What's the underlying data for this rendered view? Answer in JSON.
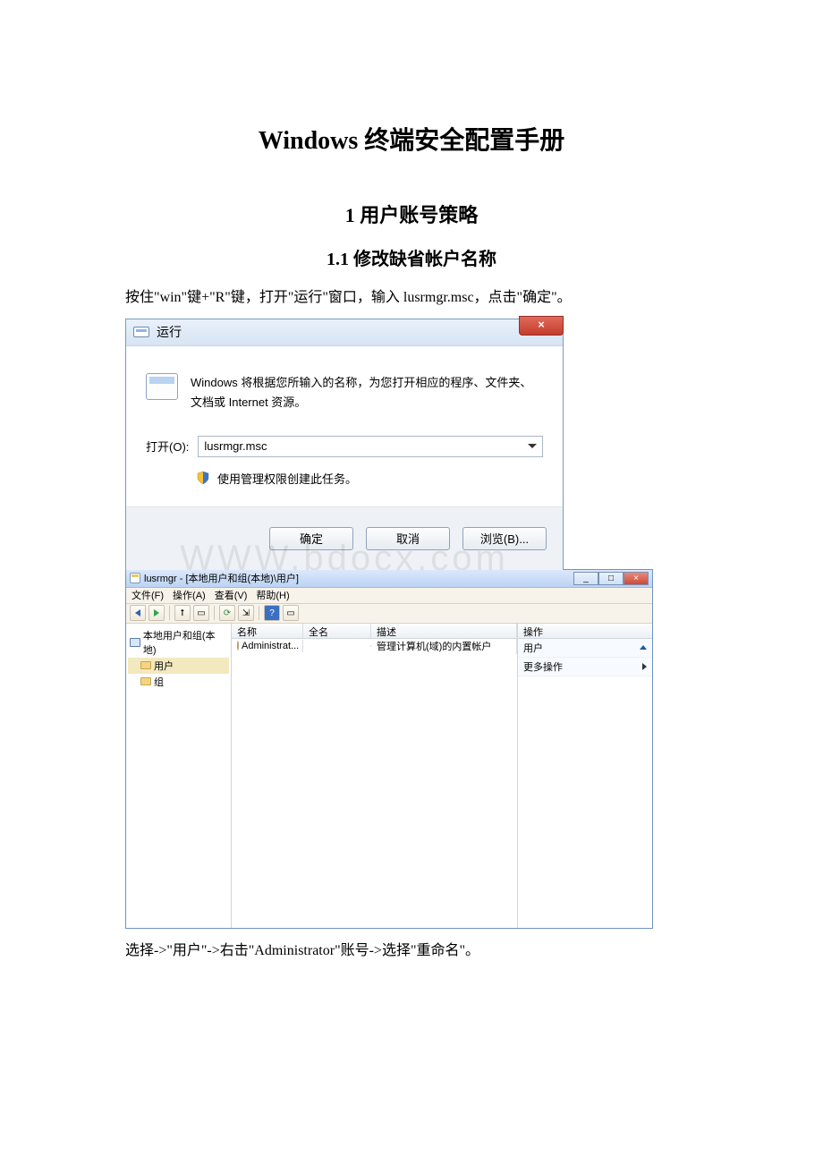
{
  "document": {
    "title": "Windows 终端安全配置手册",
    "section1": "1 用户账号策略",
    "section1_1": "1.1 修改缺省帐户名称",
    "para1": "按住\"win\"键+\"R\"键，打开\"运行\"窗口，输入 lusrmgr.msc，点击\"确定\"。",
    "para2": "选择->\"用户\"->右击\"Administrator\"账号->选择\"重命名\"。",
    "watermark": "WWW.bdocx.com"
  },
  "run_dialog": {
    "title": "运行",
    "description": "Windows 将根据您所输入的名称，为您打开相应的程序、文件夹、文档或 Internet 资源。",
    "open_label": "打开(O):",
    "open_value": "lusrmgr.msc",
    "admin_note": "使用管理权限创建此任务。",
    "ok": "确定",
    "cancel": "取消",
    "browse": "浏览(B)...",
    "close": "×"
  },
  "mmc": {
    "title": "lusrmgr - [本地用户和组(本地)\\用户]",
    "menus": {
      "file": "文件(F)",
      "action": "操作(A)",
      "view": "查看(V)",
      "help": "帮助(H)"
    },
    "tree": {
      "root": "本地用户和组(本地)",
      "users": "用户",
      "groups": "组"
    },
    "list": {
      "cols": {
        "name": "名称",
        "fullname": "全名",
        "desc": "描述"
      },
      "row": {
        "name": "Administrat...",
        "fullname": "",
        "desc": "管理计算机(域)的内置帐户"
      }
    },
    "actions": {
      "header": "操作",
      "users": "用户",
      "more": "更多操作"
    },
    "winbtns": {
      "min": "_",
      "max": "□",
      "close": "×"
    }
  }
}
